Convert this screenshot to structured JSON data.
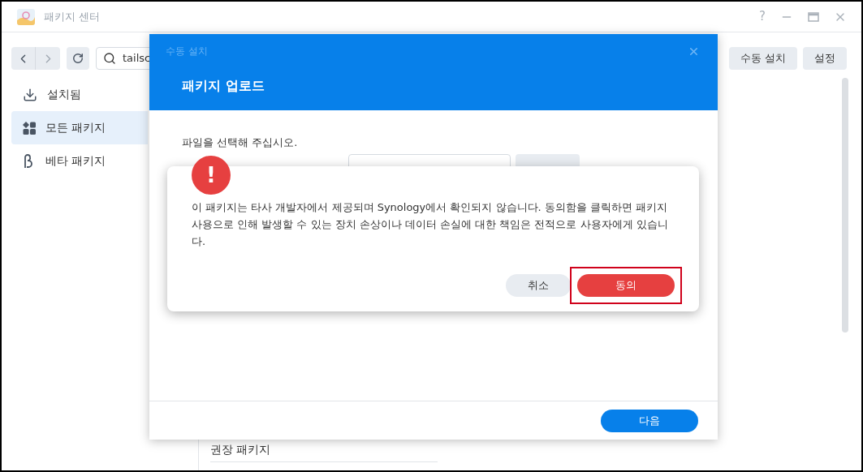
{
  "window": {
    "title": "패키지 센터",
    "help": "?"
  },
  "toolbar": {
    "search_value": "tailsc",
    "buttons": [
      "수동 설치",
      "설정"
    ]
  },
  "sidebar": {
    "items": [
      {
        "label": "설치됨",
        "kind": "installed",
        "selected": false
      },
      {
        "label": "모든 패키지",
        "kind": "all",
        "selected": true
      },
      {
        "label": "베타 패키지",
        "kind": "beta",
        "selected": false
      }
    ]
  },
  "content": {
    "section_heading": "권장 패키지"
  },
  "dialog": {
    "caption": "수동 설치",
    "title": "패키지 업로드",
    "prompt": "파일을 선택해 주십시오.",
    "next_button": "다음"
  },
  "alert": {
    "icon": "!",
    "message": "이 패키지는 타사 개발자에서 제공되며 Synology에서 확인되지 않습니다. 동의함을 클릭하면 패키지 사용으로 인해 발생할 수 있는 장치 손상이나 데이터 손실에 대한 책임은 전적으로 사용자에게 있습니다.",
    "buttons": [
      {
        "label": "취소",
        "kind": "secondary",
        "highlighted": false
      },
      {
        "label": "동의",
        "kind": "primary",
        "highlighted": true
      }
    ]
  }
}
